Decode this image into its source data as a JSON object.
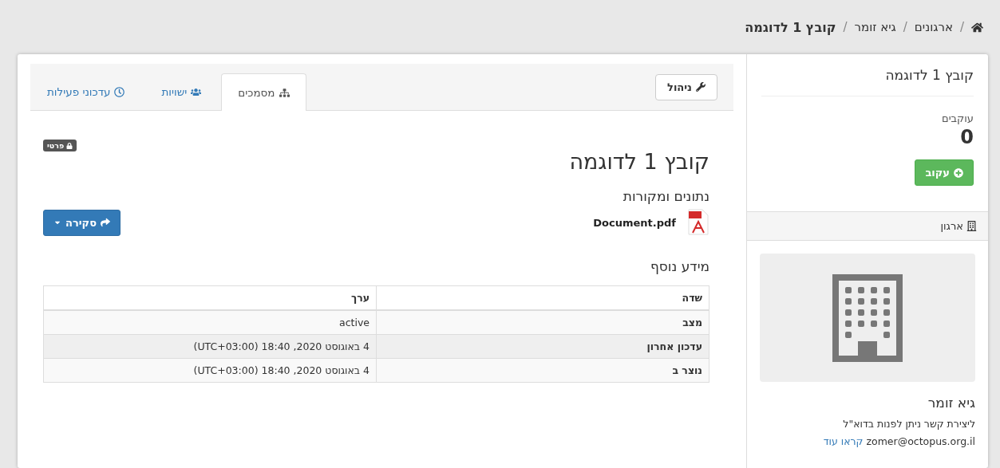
{
  "breadcrumb_separator": "/",
  "breadcrumb": [
    {
      "label": "ארגונים",
      "current": false
    },
    {
      "label": "גיא זומר",
      "current": false
    },
    {
      "label": "קובץ 1 לדוגמה",
      "current": true
    }
  ],
  "manage_button": "ניהול",
  "tabs": [
    {
      "label": "מסמכים",
      "selected": true
    },
    {
      "label": "ישויות",
      "selected": false
    },
    {
      "label": "עדכוני פעילות",
      "selected": false
    }
  ],
  "dataset": {
    "title": "קובץ 1 לדוגמה",
    "privacy_badge": "פרטי",
    "share_button": "סקירה",
    "sources_heading": "נתונים ומקורות",
    "resource": "Document.pdf",
    "additional_heading": "מידע נוסף"
  },
  "table": {
    "columns": [
      "שדה",
      "ערך"
    ],
    "rows": [
      {
        "field": "מצב",
        "value": "active"
      },
      {
        "field": "עדכון אחרון",
        "value": "4 באוגוסט 2020, 18:40 (UTC+03:00)"
      },
      {
        "field": "נוצר ב",
        "value": "4 באוגוסט 2020, 18:40 (UTC+03:00)"
      }
    ]
  },
  "sidebar": {
    "title": "קובץ 1 לדוגמה",
    "followers_label": "עוקבים",
    "followers_count": "0",
    "follow_button": "עקוב",
    "org_heading": "ארגון",
    "org_name": "גיא זומר",
    "org_description": "ליצירת קשר ניתן לפנות בדוא\"ל zomer@octopus.org.il",
    "read_more": "קראו עוד"
  }
}
